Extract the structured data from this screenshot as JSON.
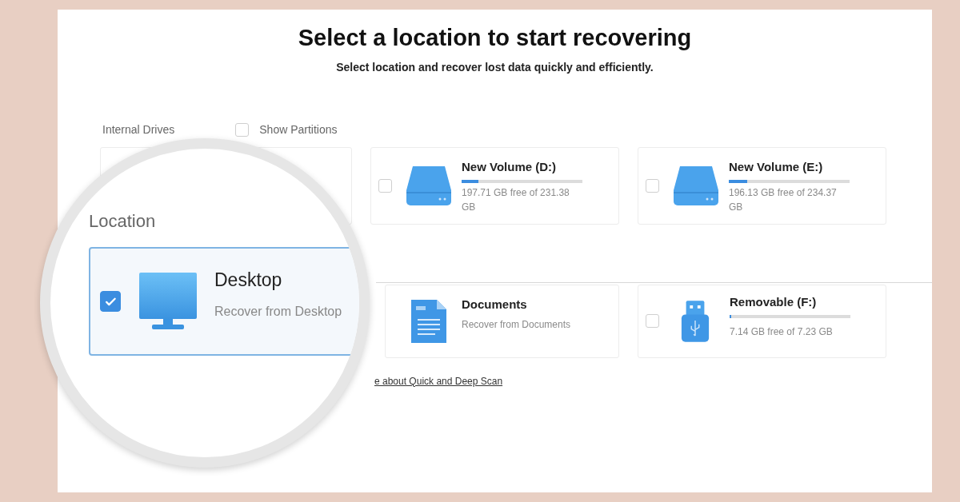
{
  "title": "Select a location to start recovering",
  "subtitle": "Select location and recover lost data quickly and efficiently.",
  "internal_drives": {
    "label": "Internal Drives",
    "show_partitions": {
      "label": "Show Partitions",
      "checked": false
    },
    "drives": [
      {
        "name": "New Volume (D:)",
        "level": 0.14,
        "reading": "197.71 GB free of 231.38 GB",
        "checked": false
      },
      {
        "name": "New Volume (E:)",
        "level": 0.15,
        "reading": "196.13 GB free of 234.37 GB",
        "checked": false
      }
    ]
  },
  "locations": [
    {
      "kind": "documents",
      "name": "Documents",
      "description": "Recover from Documents"
    },
    {
      "kind": "usb",
      "name": "Removable (F:)",
      "level": 0.01,
      "reading": "7.14 GB free of 7.23 GB",
      "checked": false
    }
  ],
  "link": "e about Quick and Deep Scan",
  "magnifier": {
    "label": "Location",
    "item": {
      "name": "Desktop",
      "description": "Recover from Desktop",
      "checked": true
    }
  }
}
